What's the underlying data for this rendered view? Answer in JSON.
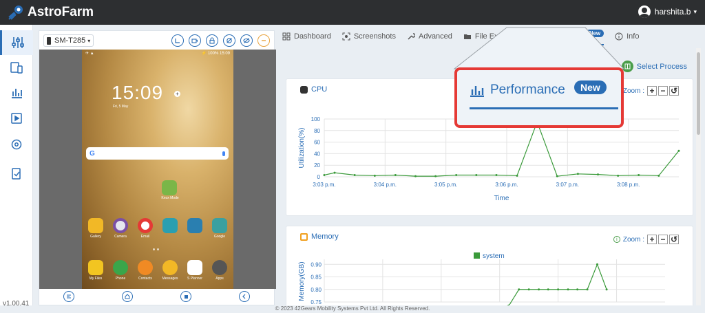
{
  "app": {
    "name": "AstroFarm",
    "version": "v1.00.41"
  },
  "user": {
    "name": "harshita.b"
  },
  "device": {
    "model": "SM-T285"
  },
  "phone": {
    "status_left": "✈ ▲",
    "status_right": "⚡ 100% 15:09",
    "time": "15:09",
    "date": "Fri, 5 May",
    "search_letter": "G",
    "knox_label": "Knox Mode",
    "apps_row1": [
      "Gallery",
      "Camera",
      "Email",
      "",
      "",
      "Google"
    ],
    "apps_row2": [
      "My Files",
      "Phone",
      "Contacts",
      "Messages",
      "S Planner",
      "Apps"
    ]
  },
  "tabs": [
    {
      "label": "Dashboard",
      "icon": "dashboard-icon"
    },
    {
      "label": "Screenshots",
      "icon": "screenshot-icon"
    },
    {
      "label": "Advanced",
      "icon": "wrench-icon"
    },
    {
      "label": "File Explorer",
      "icon": "folder-icon"
    },
    {
      "label": "Performance",
      "icon": "bar-chart-icon",
      "badge": "New",
      "active": true
    },
    {
      "label": "Info",
      "icon": "info-icon"
    }
  ],
  "select_process": "Select Process",
  "cpu_card": {
    "title": "CPU",
    "zoom_label": "Zoom :"
  },
  "memory_card": {
    "title": "Memory",
    "zoom_label": "Zoom :"
  },
  "zoom_buttons": {
    "plus": "+",
    "minus": "−",
    "reset": "↺"
  },
  "callout": {
    "label": "Performance",
    "badge": "New"
  },
  "footer": "© 2023 42Gears Mobility Systems Pvt Ltd. All Rights Reserved.",
  "colors": {
    "accent": "#2a6db5",
    "line": "#3a9a3a",
    "callout_border": "#e53935",
    "topbar": "#2d2f31"
  },
  "chart_data": [
    {
      "type": "line",
      "title": "CPU",
      "xlabel": "Time",
      "ylabel": "Utilization(%)",
      "ylim": [
        0,
        100
      ],
      "yticks": [
        0,
        20,
        40,
        60,
        80,
        100
      ],
      "x_tick_labels": [
        "3:03 p.m.",
        "3:04 p.m.",
        "3:05 p.m.",
        "3:06 p.m.",
        "3:07 p.m.",
        "3:08 p.m."
      ],
      "x_minutes": [
        0,
        1,
        2,
        3,
        4,
        5
      ],
      "grid": true,
      "series": [
        {
          "x": [
            0,
            0.17,
            0.5,
            0.83,
            1.17,
            1.5,
            1.83,
            2.17,
            2.5,
            2.83,
            3.17,
            3.5,
            3.83,
            4.17,
            4.5,
            4.83,
            5.17,
            5.5,
            5.83
          ],
          "y": [
            3,
            7,
            3,
            2,
            3,
            1,
            1,
            3,
            3,
            3,
            2,
            95,
            1,
            5,
            4,
            2,
            3,
            2,
            45
          ]
        }
      ]
    },
    {
      "type": "line",
      "title": "Memory",
      "ylabel": "Memory(GB)",
      "yticks": [
        0.75,
        0.8,
        0.85,
        0.9
      ],
      "ylim": [
        0.75,
        0.92
      ],
      "legend": "top-center",
      "grid": true,
      "series": [
        {
          "name": "system",
          "x": [
            3.0,
            3.17,
            3.33,
            3.5,
            3.67,
            3.83,
            4.0,
            4.17,
            4.33,
            4.5,
            4.67,
            4.83
          ],
          "y": [
            0.72,
            0.74,
            0.8,
            0.8,
            0.8,
            0.8,
            0.8,
            0.8,
            0.8,
            0.8,
            0.9,
            0.8
          ]
        }
      ]
    }
  ]
}
